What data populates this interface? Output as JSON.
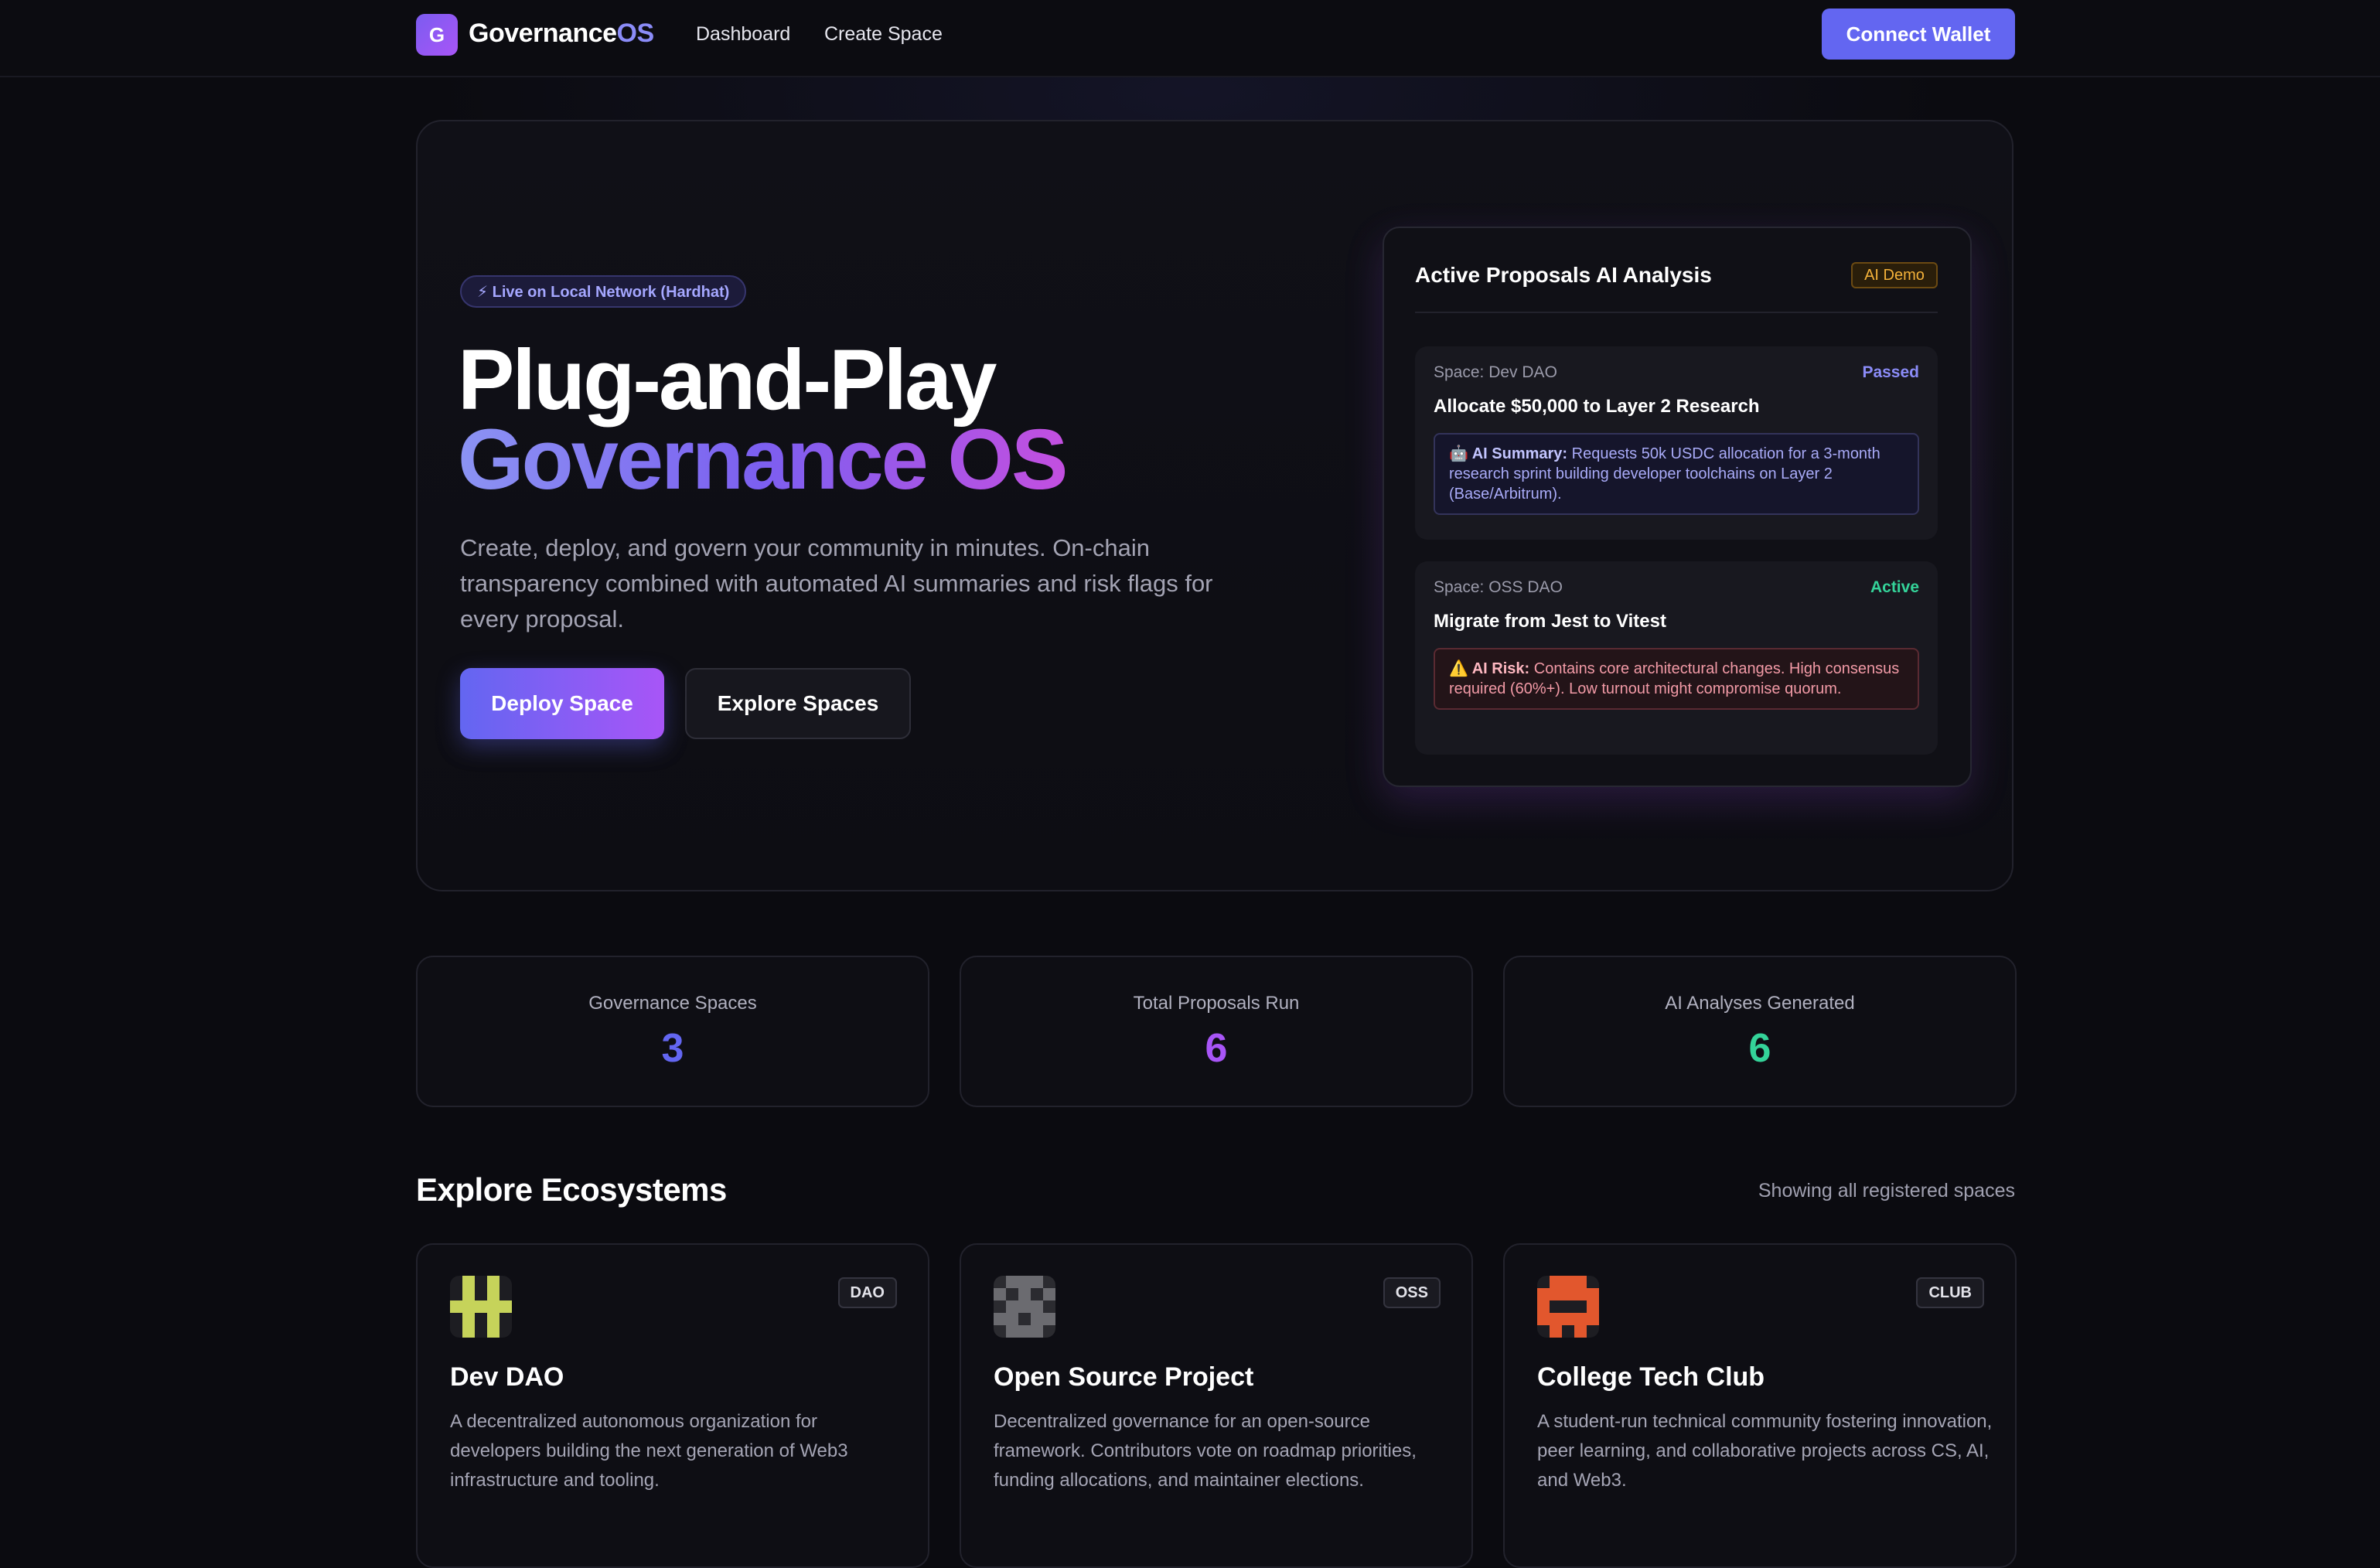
{
  "nav": {
    "logo_letter": "G",
    "brand_main": "Governance",
    "brand_accent": "OS",
    "links": [
      "Dashboard",
      "Create Space"
    ],
    "connect_label": "Connect Wallet"
  },
  "hero": {
    "badge": "⚡ Live on Local Network (Hardhat)",
    "title_line1": "Plug-and-Play",
    "title_line2": "Governance OS",
    "description": "Create, deploy, and govern your community in minutes. On-chain transparency combined with automated AI summaries and risk flags for every proposal.",
    "deploy_label": "Deploy Space",
    "explore_label": "Explore Spaces"
  },
  "ai_panel": {
    "title": "Active Proposals AI Analysis",
    "badge": "AI Demo",
    "proposals": [
      {
        "space": "Space: Dev DAO",
        "status": "Passed",
        "status_color": "#8b8cf8",
        "title": "Allocate $50,000 to Layer 2 Research",
        "note_label": "🤖 AI Summary:",
        "note_text": "Requests 50k USDC allocation for a 3-month research sprint building developer toolchains on Layer 2 (Base/Arbitrum)."
      },
      {
        "space": "Space: OSS DAO",
        "status": "Active",
        "status_color": "#34d399",
        "title": "Migrate from Jest to Vitest",
        "note_label": "⚠️ AI Risk:",
        "note_text": "Contains core architectural changes. High consensus required (60%+). Low turnout might compromise quorum."
      }
    ]
  },
  "stats": [
    {
      "label": "Governance Spaces",
      "value": "3",
      "color": "#6366f1"
    },
    {
      "label": "Total Proposals Run",
      "value": "6",
      "color": "#a855f7"
    },
    {
      "label": "AI Analyses Generated",
      "value": "6",
      "color": "#34d399"
    }
  ],
  "ecosystems": {
    "title": "Explore Ecosystems",
    "subtitle": "Showing all registered spaces",
    "spaces": [
      {
        "name": "Dev DAO",
        "tag": "DAO",
        "icon": "dev-dao-identicon",
        "description": "A decentralized autonomous organization for developers building the next generation of Web3 infrastructure and tooling."
      },
      {
        "name": "Open Source Project",
        "tag": "OSS",
        "icon": "open-source-identicon",
        "description": "Decentralized governance for an open-source framework. Contributors vote on roadmap priorities, funding allocations, and maintainer elections."
      },
      {
        "name": "College Tech Club",
        "tag": "CLUB",
        "icon": "college-club-identicon",
        "description": "A student-run technical community fostering innovation, peer learning, and collaborative projects across CS, AI, and Web3."
      }
    ]
  },
  "colors": {
    "accent": "#6366f1",
    "accent_purple": "#a855f7",
    "success": "#34d399",
    "warning": "#f4b23a",
    "danger": "#f29aa6"
  }
}
